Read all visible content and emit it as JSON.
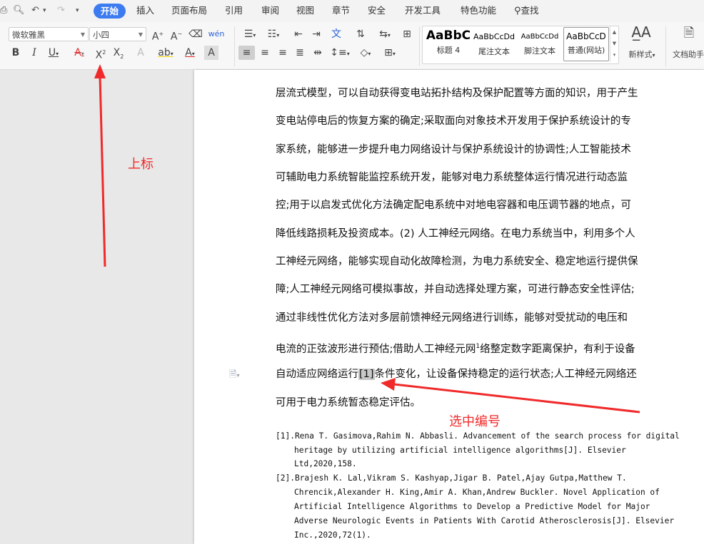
{
  "menu_tabs": [
    "开始",
    "插入",
    "页面布局",
    "引用",
    "审阅",
    "视图",
    "章节",
    "安全",
    "开发工具",
    "特色功能",
    "查找"
  ],
  "font": {
    "family_value": "微软雅黑",
    "size_value": "小四"
  },
  "styles": [
    {
      "preview": "AaBbC",
      "label": "标题 4"
    },
    {
      "preview": "AaBbCcDd",
      "label": "尾注文本"
    },
    {
      "preview": "AaBbCcDd",
      "label": "脚注文本"
    },
    {
      "preview": "AaBbCcD",
      "label": "普通(网站)"
    }
  ],
  "ribbon_labels": {
    "new_style": "新样式",
    "doc_helper": "文档助手"
  },
  "annotations": {
    "superscript": "上标",
    "select_number": "选中编号"
  },
  "body_lines": [
    "层流式模型，可以自动获得变电站拓扑结构及保护配置等方面的知识，用于产生",
    "变电站停电后的恢复方案的确定;采取面向对象技术开发用于保护系统设计的专",
    "家系统，能够进一步提升电力网络设计与保护系统设计的协调性;人工智能技术",
    "可辅助电力系统智能监控系统开发，能够对电力系统整体运行情况进行动态监",
    "控;用于以启发式优化方法确定配电系统中对地电容器和电压调节器的地点，可",
    "降低线路损耗及投资成本。(2) 人工神经元网络。在电力系统当中，利用多个人",
    "工神经元网络，能够实现自动化故障检测，为电力系统安全、稳定地运行提供保",
    "障;人工神经元网络可模拟事故，并自动选择处理方案，可进行静态安全性评估;",
    "通过非线性优化方法对多层前馈神经元网络进行训练，能够对受扰动的电压和"
  ],
  "line10": {
    "before": "电流的正弦波形进行预估;借助人工神经元网",
    "sup": "1",
    "after": "络整定数字距离保护，有利于设备"
  },
  "line11": {
    "before": "自动适应网络运行",
    "selected": "[1]",
    "after": "条件变化，让设备保持稳定的运行状态;人工神经元网络还"
  },
  "line12": "可用于电力系统暂态稳定评估。",
  "references": [
    [
      "[1].Rena T. Gasimova,Rahim N. Abbasli. Advancement of the search process for digital",
      "heritage by utilizing artificial intelligence algorithms[J]. Elsevier",
      "Ltd,2020,158."
    ],
    [
      "[2].Brajesh K. Lal,Vikram S. Kashyap,Jigar B. Patel,Ajay Gutpa,Matthew T.",
      "Chrencik,Alexander H. King,Amir A. Khan,Andrew Buckler. Novel Application of",
      "Artificial Intelligence Algorithms to Develop a Predictive Model for Major",
      "Adverse Neurologic Events in Patients With Carotid Atherosclerosis[J]. Elsevier",
      "Inc.,2020,72(1)."
    ]
  ],
  "colors": {
    "accent": "#3d7bf0",
    "annotation": "#f02a2a"
  }
}
